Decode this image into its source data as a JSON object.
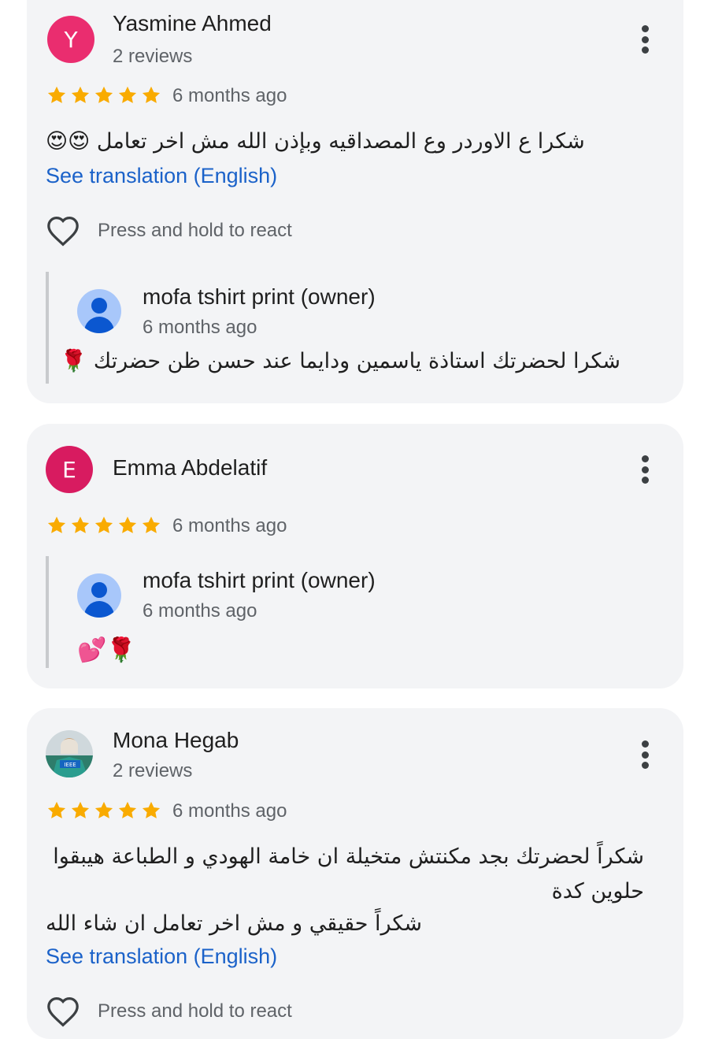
{
  "colors": {
    "card_bg": "#f3f4f6",
    "star": "#f9ab00",
    "link": "#1b62c9",
    "avatar_y": "#ea2d6f",
    "avatar_e": "#d81b60",
    "owner_avatar": "#a8c7fa"
  },
  "reviews": [
    {
      "avatar_letter": "Y",
      "name": "Yasmine Ahmed",
      "review_count": "2 reviews",
      "rating": 5,
      "time": "6 months ago",
      "text": "شكرا ع الاوردر وع المصداقيه وبإذن الله مش اخر تعامل 😍😍",
      "translate_link": "See translation (English)",
      "react_label": "Press and hold to react",
      "reply": {
        "owner_name": "mofa tshirt print (owner)",
        "time": "6 months ago",
        "text": "شكرا لحضرتك استاذة ياسمين ودايما عند حسن ظن حضرتك 🌹"
      }
    },
    {
      "avatar_letter": "E",
      "name": "Emma Abdelatif",
      "rating": 5,
      "time": "6 months ago",
      "reply": {
        "owner_name": "mofa tshirt print (owner)",
        "time": "6 months ago",
        "text": "💕🌹"
      }
    },
    {
      "avatar_icon": "profile-photo",
      "name": "Mona Hegab",
      "review_count": "2 reviews",
      "rating": 5,
      "time": "6 months ago",
      "text_line1": "شكراً لحضرتك بجد مكنتش متخيلة ان خامة الهودي و الطباعة هيبقوا حلوين كدة",
      "text_line2": "شكراً حقيقي و مش اخر تعامل ان شاء الله",
      "translate_link": "See translation (English)",
      "react_label": "Press and hold to react"
    }
  ]
}
